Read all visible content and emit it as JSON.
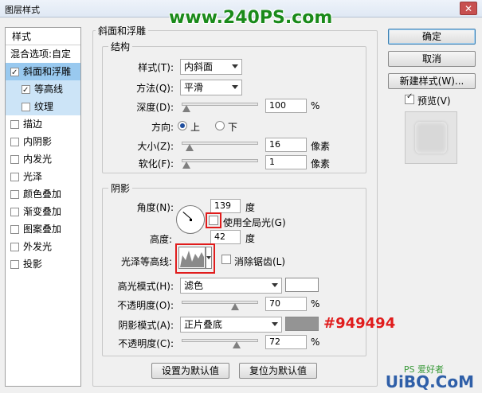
{
  "window": {
    "title": "图层样式",
    "close_glyph": "✕"
  },
  "watermark_top": "www.240PS.com",
  "style_list": {
    "header": "样式",
    "blend_options": "混合选项:自定",
    "items": [
      {
        "label": "斜面和浮雕",
        "checked": true
      },
      {
        "label": "等高线",
        "checked": true
      },
      {
        "label": "纹理",
        "checked": false
      },
      {
        "label": "描边",
        "checked": false
      },
      {
        "label": "内阴影",
        "checked": false
      },
      {
        "label": "内发光",
        "checked": false
      },
      {
        "label": "光泽",
        "checked": false
      },
      {
        "label": "颜色叠加",
        "checked": false
      },
      {
        "label": "渐变叠加",
        "checked": false
      },
      {
        "label": "图案叠加",
        "checked": false
      },
      {
        "label": "外发光",
        "checked": false
      },
      {
        "label": "投影",
        "checked": false
      }
    ]
  },
  "bevel": {
    "group_title": "斜面和浮雕",
    "structure_title": "结构",
    "style_label": "样式(T):",
    "style_value": "内斜面",
    "technique_label": "方法(Q):",
    "technique_value": "平滑",
    "depth_label": "深度(D):",
    "depth_value": "100",
    "depth_unit": "%",
    "depth_slider_fraction": 0.0,
    "direction_label": "方向:",
    "dir_up": "上",
    "dir_down": "下",
    "size_label": "大小(Z):",
    "size_value": "16",
    "size_unit": "像素",
    "size_slider_fraction": 0.04,
    "soften_label": "软化(F):",
    "soften_value": "1",
    "soften_unit": "像素",
    "soften_slider_fraction": 0.0
  },
  "shading": {
    "group_title": "阴影",
    "angle_label": "角度(N):",
    "angle_value": "139",
    "angle_unit": "度",
    "global_light_label": "使用全局光(G)",
    "altitude_label": "高度:",
    "altitude_value": "42",
    "altitude_unit": "度",
    "gloss_contour_label": "光泽等高线:",
    "anti_alias_label": "消除锯齿(L)",
    "highlight_mode_label": "高光模式(H):",
    "highlight_mode_value": "滤色",
    "highlight_color": "#ffffff",
    "highlight_opacity_label": "不透明度(O):",
    "highlight_opacity_value": "70",
    "highlight_opacity_unit": "%",
    "highlight_opacity_fraction": 0.7,
    "shadow_mode_label": "阴影模式(A):",
    "shadow_mode_value": "正片叠底",
    "shadow_color": "#949494",
    "shadow_color_annotation": "#949494",
    "shadow_opacity_label": "不透明度(C):",
    "shadow_opacity_value": "72",
    "shadow_opacity_unit": "%",
    "shadow_opacity_fraction": 0.72
  },
  "buttons": {
    "make_default": "设置为默认值",
    "reset_default": "复位为默认值",
    "ok": "确定",
    "cancel": "取消",
    "new_style": "新建样式(W)...",
    "preview_label": "预览(V)"
  },
  "watermark_bottom": "UiBQ.CoM",
  "watermark_bottom_small": "PS 爱好者"
}
